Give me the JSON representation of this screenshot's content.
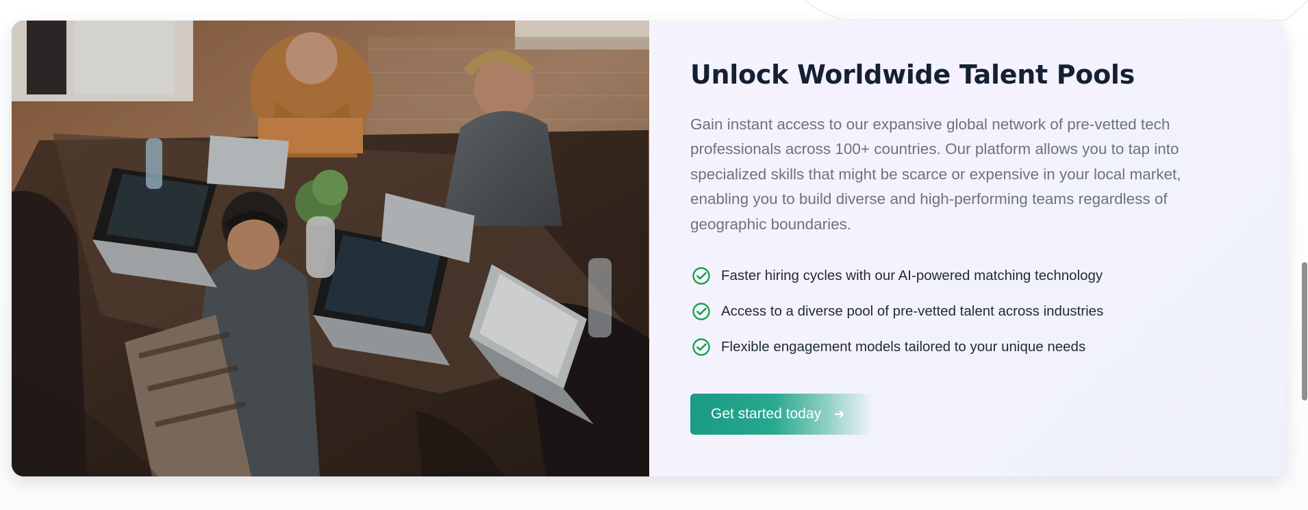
{
  "section": {
    "title": "Unlock Worldwide Talent Pools",
    "description": "Gain instant access to our expansive global network of pre-vetted tech professionals across 100+ countries. Our platform allows you to tap into specialized skills that might be scarce or expensive in your local market, enabling you to build diverse and high-performing teams regardless of geographic boundaries.",
    "features": [
      {
        "text": "Faster hiring cycles with our AI-powered matching technology",
        "icon": "check-circle-icon"
      },
      {
        "text": "Access to a diverse pool of pre-vetted talent across industries",
        "icon": "check-circle-icon"
      },
      {
        "text": "Flexible engagement models tailored to your unique needs",
        "icon": "check-circle-icon"
      }
    ],
    "cta": {
      "label": "Get started today",
      "icon": "arrow-right-icon"
    }
  },
  "colors": {
    "heading": "#142033",
    "body": "#6c7280",
    "success": "#16a34a",
    "cta": "#1b9a84",
    "panel": "#f4f3fd"
  }
}
